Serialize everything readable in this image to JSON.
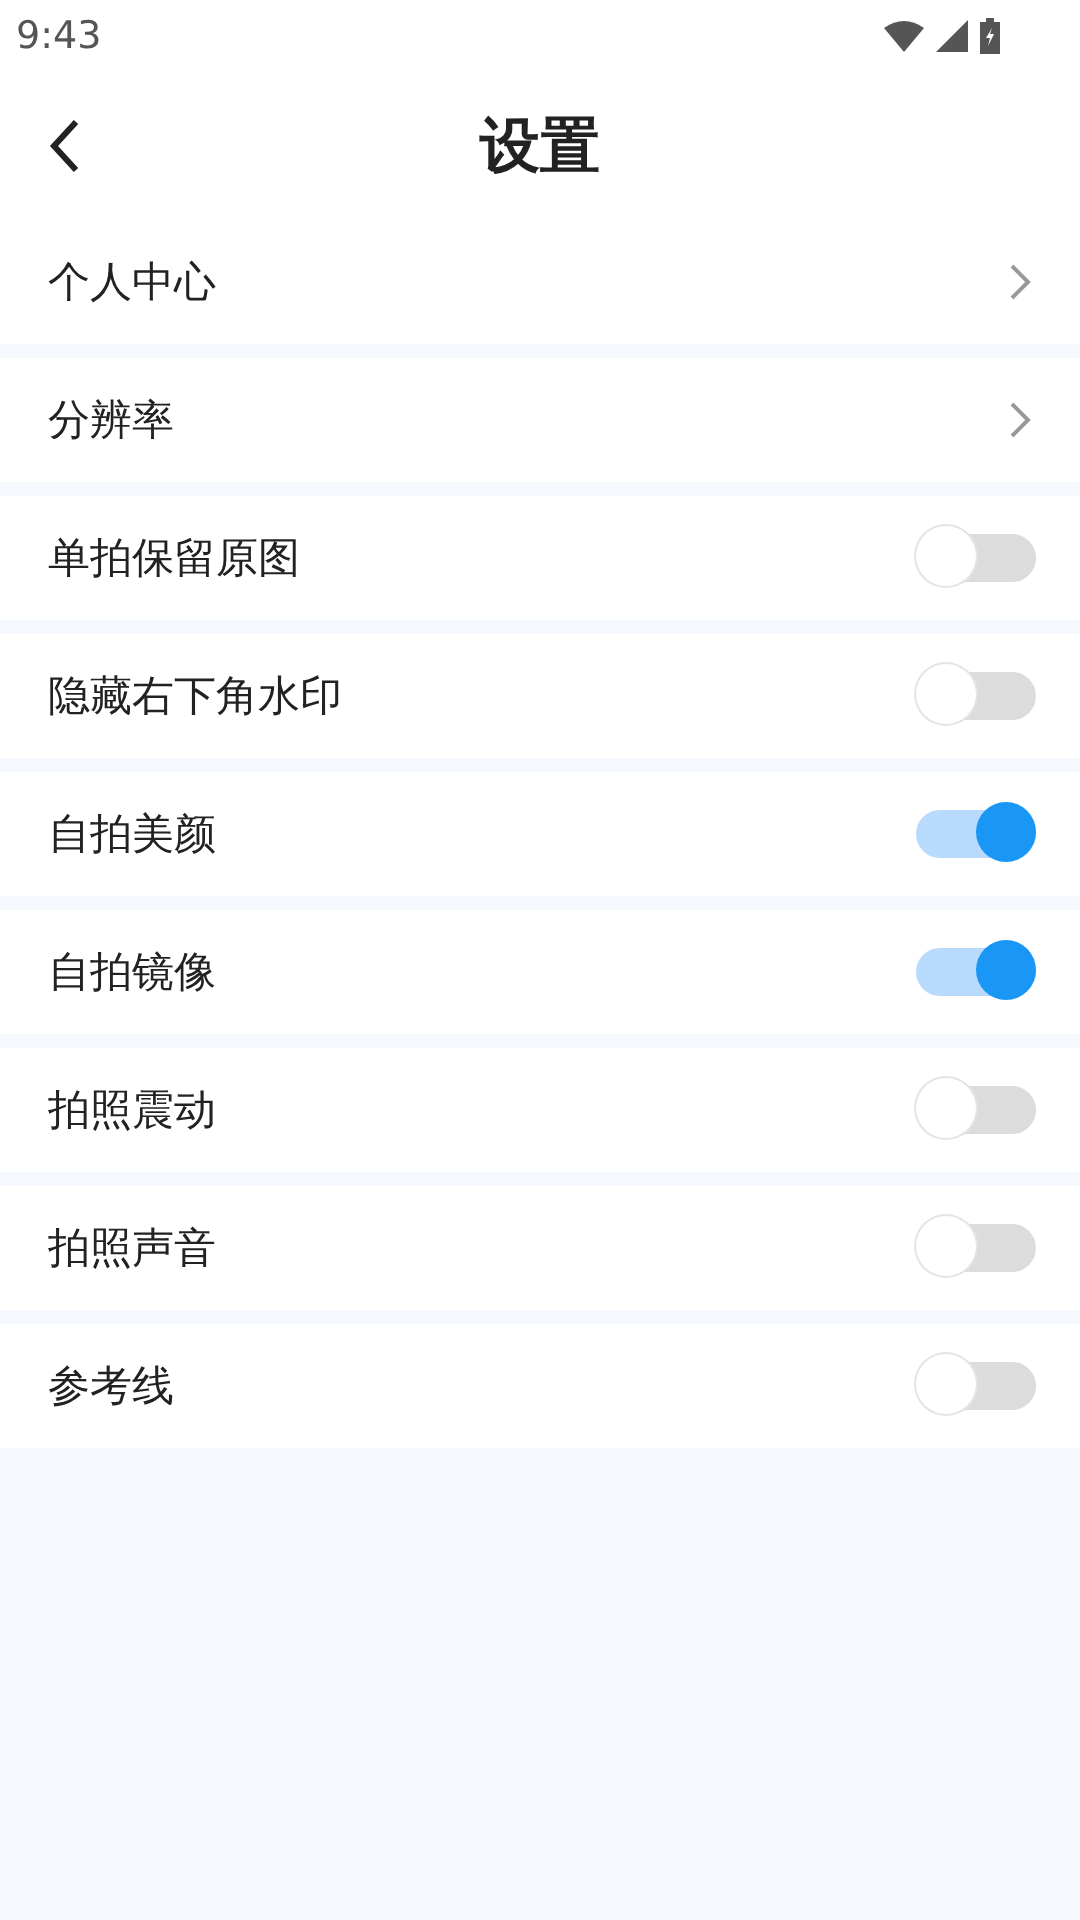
{
  "status_bar": {
    "time": "9:43"
  },
  "header": {
    "title": "设置"
  },
  "items": [
    {
      "kind": "link",
      "label": "个人中心"
    },
    {
      "kind": "link",
      "label": "分辨率"
    },
    {
      "kind": "toggle",
      "label": "单拍保留原图",
      "on": false
    },
    {
      "kind": "toggle",
      "label": "隐藏右下角水印",
      "on": false
    },
    {
      "kind": "toggle",
      "label": "自拍美颜",
      "on": true
    },
    {
      "kind": "toggle",
      "label": "自拍镜像",
      "on": true
    },
    {
      "kind": "toggle",
      "label": "拍照震动",
      "on": false
    },
    {
      "kind": "toggle",
      "label": "拍照声音",
      "on": false
    },
    {
      "kind": "toggle",
      "label": "参考线",
      "on": false
    }
  ]
}
